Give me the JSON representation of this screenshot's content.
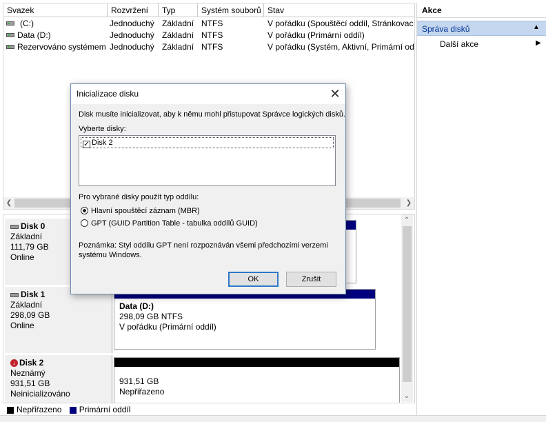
{
  "volume_list": {
    "columns": [
      "Svazek",
      "Rozvržení",
      "Typ",
      "Systém souborů",
      "Stav"
    ],
    "rows": [
      {
        "name": "(C:)",
        "layout": "Jednoduchý",
        "type": "Základní",
        "fs": "NTFS",
        "status": "V pořádku (Spouštěcí oddíl, Stránkovací"
      },
      {
        "name": "Data (D:)",
        "layout": "Jednoduchý",
        "type": "Základní",
        "fs": "NTFS",
        "status": "V pořádku (Primární oddíl)"
      },
      {
        "name": "Rezervováno systémem",
        "layout": "Jednoduchý",
        "type": "Základní",
        "fs": "NTFS",
        "status": "V pořádku (Systém, Aktivní, Primární odd"
      }
    ]
  },
  "disks": [
    {
      "title": "Disk 0",
      "kind": "Základní",
      "size": "111,79 GB",
      "state": "Online"
    },
    {
      "title": "Disk 1",
      "kind": "Základní",
      "size": "298,09 GB",
      "state": "Online"
    },
    {
      "title": "Disk 2",
      "kind": "Neznámý",
      "size": "931,51 GB",
      "state": "Neinicializováno"
    }
  ],
  "partitions": {
    "disk1": {
      "name": "Data  (D:)",
      "size": "298,09 GB NTFS",
      "status": "V pořádku (Primární oddíl)"
    },
    "disk2": {
      "size": "931,51 GB",
      "status": "Nepřiřazeno"
    }
  },
  "legend": {
    "unallocated": "Nepřiřazeno",
    "primary": "Primární oddíl"
  },
  "actions": {
    "title": "Akce",
    "section": "Správa disků",
    "more": "Další akce"
  },
  "dialog": {
    "title": "Inicializace disku",
    "intro": "Disk musíte inicializovat, aby k němu mohl přistupovat Správce logických disků.",
    "select_label": "Vyberte disky:",
    "disk_item": "Disk 2",
    "disk_item_checked": true,
    "partition_style_label": "Pro vybrané disky použít typ oddílu:",
    "option_mbr": "Hlavní spouštěcí záznam (MBR)",
    "option_gpt": "GPT (GUID Partition Table - tabulka oddílů GUID)",
    "selected_option": "mbr",
    "note_line1": "Poznámka: Styl oddílu GPT není rozpoznáván všemi předchozími verzemi",
    "note_line2": "systému Windows.",
    "ok_label": "OK",
    "cancel_label": "Zrušit"
  },
  "colors": {
    "primary_partition": "#00007f",
    "unallocated": "#000000",
    "actions_section_bg": "#c4d7ee",
    "default_button_border": "#2d78c9"
  }
}
